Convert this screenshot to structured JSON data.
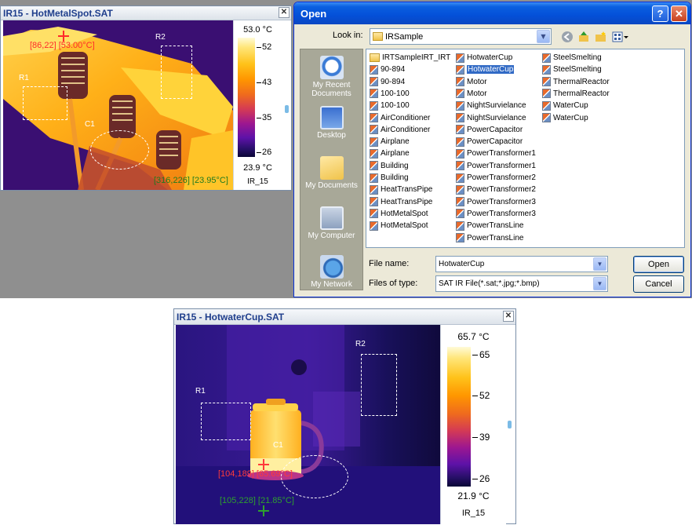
{
  "window1": {
    "title": "IR15 - HotMetalSpot.SAT",
    "close_glyph": "✕",
    "scale_max": "53.0 °C",
    "scale_min": "23.9 °C",
    "scale_ticks": [
      "52",
      "43",
      "35",
      "26"
    ],
    "scale_name": "IR_15",
    "roi_r1": "R1",
    "roi_r2": "R2",
    "roi_c1": "C1",
    "cursor_hot_text": "[86,22] [53.00°C]",
    "cursor_low_text": "[316,226] [23.95°C]"
  },
  "open_dialog": {
    "title": "Open",
    "help_glyph": "?",
    "close_glyph": "✕",
    "look_in_label": "Look in:",
    "look_in_value": "IRSample",
    "places": [
      "My Recent Documents",
      "Desktop",
      "My Documents",
      "My Computer",
      "My Network"
    ],
    "files": [
      {
        "name": "IRTSampleIRT_IRT",
        "type": "folder"
      },
      {
        "name": "90-894",
        "type": "file"
      },
      {
        "name": "90-894",
        "type": "file"
      },
      {
        "name": "100-100",
        "type": "file"
      },
      {
        "name": "100-100",
        "type": "file"
      },
      {
        "name": "AirConditioner",
        "type": "file"
      },
      {
        "name": "AirConditioner",
        "type": "file"
      },
      {
        "name": "Airplane",
        "type": "file"
      },
      {
        "name": "Airplane",
        "type": "file"
      },
      {
        "name": "Building",
        "type": "file"
      },
      {
        "name": "Building",
        "type": "file"
      },
      {
        "name": "HeatTransPipe",
        "type": "file"
      },
      {
        "name": "HeatTransPipe",
        "type": "file"
      },
      {
        "name": "HotMetalSpot",
        "type": "file"
      },
      {
        "name": "HotMetalSpot",
        "type": "file"
      },
      {
        "name": "HotwaterCup",
        "type": "file"
      },
      {
        "name": "HotwaterCup",
        "type": "file",
        "selected": true
      },
      {
        "name": "Motor",
        "type": "file"
      },
      {
        "name": "Motor",
        "type": "file"
      },
      {
        "name": "NightSurvielance",
        "type": "file"
      },
      {
        "name": "NightSurvielance",
        "type": "file"
      },
      {
        "name": "PowerCapacitor",
        "type": "file"
      },
      {
        "name": "PowerCapacitor",
        "type": "file"
      },
      {
        "name": "PowerTransformer1",
        "type": "file"
      },
      {
        "name": "PowerTransformer1",
        "type": "file"
      },
      {
        "name": "PowerTransformer2",
        "type": "file"
      },
      {
        "name": "PowerTransformer2",
        "type": "file"
      },
      {
        "name": "PowerTransformer3",
        "type": "file"
      },
      {
        "name": "PowerTransformer3",
        "type": "file"
      },
      {
        "name": "PowerTransLine",
        "type": "file"
      },
      {
        "name": "PowerTransLine",
        "type": "file"
      },
      {
        "name": "SteelSmelting",
        "type": "file"
      },
      {
        "name": "SteelSmelting",
        "type": "file"
      },
      {
        "name": "ThermalReactor",
        "type": "file"
      },
      {
        "name": "ThermalReactor",
        "type": "file"
      },
      {
        "name": "WaterCup",
        "type": "file"
      },
      {
        "name": "WaterCup",
        "type": "file"
      }
    ],
    "file_name_label": "File name:",
    "file_name_value": "HotwaterCup",
    "file_type_label": "Files of type:",
    "file_type_value": "SAT IR File(*.sat;*.jpg;*.bmp)",
    "open_button": "Open",
    "cancel_button": "Cancel"
  },
  "window2": {
    "title": "IR15 - HotwaterCup.SAT",
    "close_glyph": "✕",
    "scale_max": "65.7 °C",
    "scale_min": "21.9 °C",
    "scale_ticks": [
      "65",
      "52",
      "39",
      "26"
    ],
    "scale_name": "IR_15",
    "roi_r1": "R1",
    "roi_r2": "R2",
    "roi_c1": "C1",
    "cursor_hot_text": "[104,189] [65.69°C]",
    "cursor_low_text": "[105,228] [21.85°C]"
  },
  "icons": {
    "combo_arrow": "chevron-down-icon",
    "back": "back-arrow-icon",
    "up": "up-folder-icon",
    "new_folder": "new-folder-icon",
    "view_menu": "view-menu-icon"
  },
  "colors": {
    "xp_title_blue": "#0450d8",
    "ir_title_text": "#1f3e8c",
    "hot_cursor": "#ff2a2a",
    "cold_cursor": "#2ea02e",
    "selection": "#316ac5"
  }
}
